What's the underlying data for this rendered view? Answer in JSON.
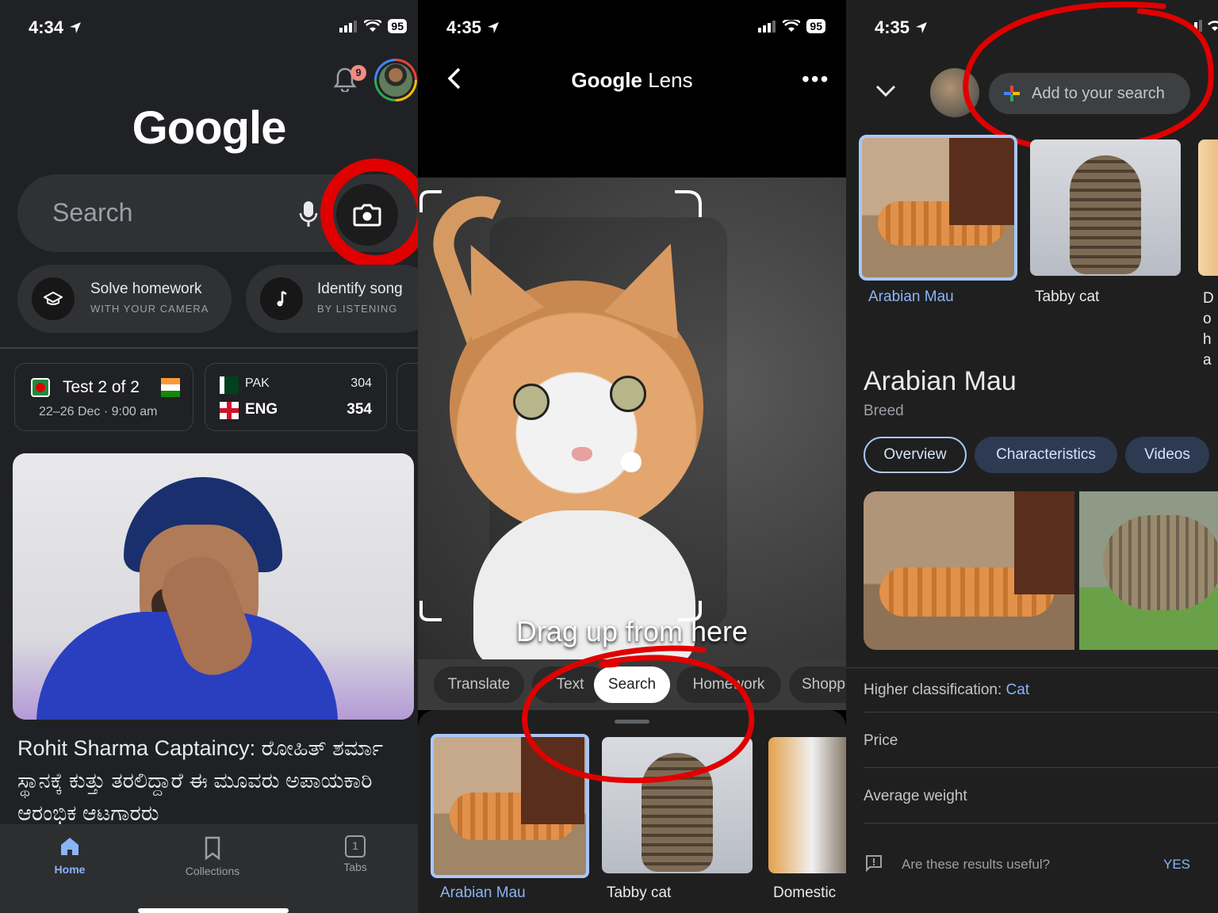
{
  "panel1": {
    "status": {
      "time": "4:34",
      "battery": "95"
    },
    "notification_count": "9",
    "logo": "Google",
    "search": {
      "placeholder": "Search"
    },
    "chips": [
      {
        "title": "Solve homework",
        "subtitle": "WITH YOUR CAMERA",
        "icon": "graduation-cap-icon"
      },
      {
        "title": "Identify song",
        "subtitle": "BY LISTENING",
        "icon": "music-note-icon"
      }
    ],
    "cricket": {
      "match_title": "Test 2 of 2",
      "match_date": "22–26 Dec · 9:00 am",
      "team1": "PAK",
      "team1_score": "304",
      "team2": "ENG",
      "team2_score": "354"
    },
    "news_headline": "Rohit Sharma Captaincy: ರೋಹಿತ್ ಶರ್ಮಾ ಸ್ಥಾನಕ್ಕೆ ಕುತ್ತು ತರಲಿದ್ದಾರೆ ಈ ಮೂವರು ಅಪಾಯಕಾರಿ ಆರಂಭಿಕ ಆಟಗಾರರು",
    "bottom_nav": [
      {
        "label": "Home",
        "active": true
      },
      {
        "label": "Collections",
        "active": false
      },
      {
        "label": "Tabs",
        "active": false,
        "count": "1"
      }
    ]
  },
  "panel2": {
    "status": {
      "time": "4:35",
      "battery": "95"
    },
    "title_google": "Google",
    "title_lens": "Lens",
    "drag_hint": "Drag up from here",
    "modes": [
      "Translate",
      "Text",
      "Search",
      "Homework",
      "Shopp"
    ],
    "active_mode": "Search",
    "results": [
      {
        "label": "Arabian Mau"
      },
      {
        "label": "Tabby cat"
      },
      {
        "label": "Domestic"
      }
    ]
  },
  "panel3": {
    "status": {
      "time": "4:35"
    },
    "add_to_search": "Add to your search",
    "results": [
      {
        "label": "Arabian Mau"
      },
      {
        "label": "Tabby cat"
      },
      {
        "label": "Do ha"
      }
    ],
    "entity_title": "Arabian Mau",
    "entity_type": "Breed",
    "tabs": [
      "Overview",
      "Characteristics",
      "Videos"
    ],
    "classification_label": "Higher classification:",
    "classification_value": "Cat",
    "rows": [
      "Price",
      "Average weight"
    ],
    "feedback_question": "Are these results useful?",
    "feedback_yes": "YES"
  },
  "colors": {
    "annotation_red": "#e00000",
    "accent_blue": "#8ab4f8",
    "dark_bg": "#202124"
  }
}
